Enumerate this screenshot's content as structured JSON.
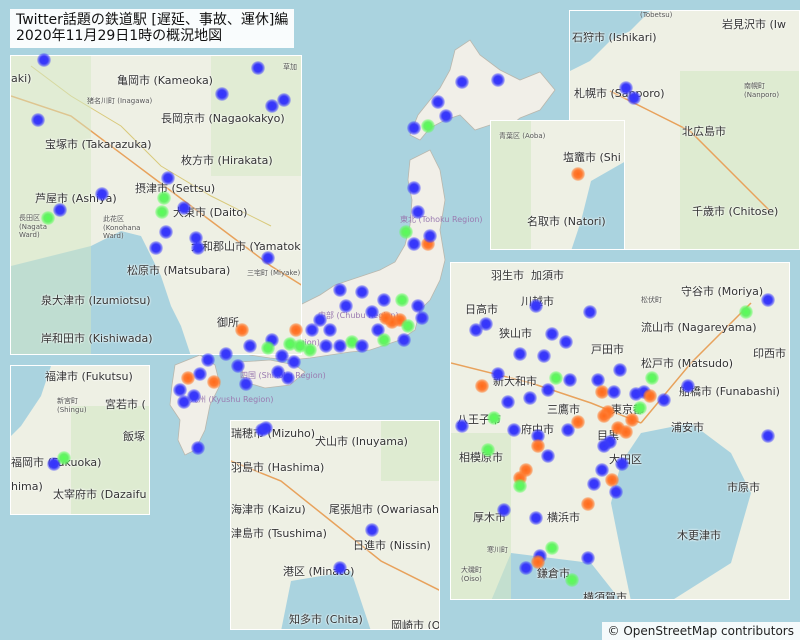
{
  "title": {
    "line1": "Twitter話題の鉄道駅 [遅延、事故、運休]編",
    "line2": "2020年11月29日1時の概況地図"
  },
  "attribution": "© OpenStreetMap contributors",
  "colors": {
    "delay": "#3a3af8",
    "normal": "#55ee55",
    "severe": "#ff6a1a",
    "sea": "#aad3df",
    "land": "#eef0e4"
  },
  "mainmap": {
    "region_labels": [
      "東北 (Tohoku Region)",
      "中部 (Chubu Region)",
      "中国 (Chugoku Region)",
      "四国 (Shikoku Region)",
      "九州 (Kyushu Region)"
    ]
  },
  "insets": {
    "kansai": {
      "labels": [
        "亀岡市 (Kameoka)",
        "猪名川町 (Inagawa)",
        "長岡京市 (Nagaokakyo)",
        "宝塚市 (Takarazuka)",
        "枚方市 (Hirakata)",
        "芦屋市 (Ashiya)",
        "摂津市 (Settsu)",
        "大東市 (Daito)",
        "長田区 (Nagata Ward)",
        "此花区 (Konohana Ward)",
        "大和郡山市 (Yamatok",
        "松原市 (Matsubara)",
        "三宅町 (Miyake)",
        "泉大津市 (Izumiotsu)",
        "岸和田市 (Kishiwada)",
        "御所",
        "草加",
        "aki)"
      ]
    },
    "sapporo": {
      "labels": [
        "(Tobetsu)",
        "岩見沢市 (Iw",
        "石狩市 (Ishikari)",
        "札幌市 (Sapporo)",
        "南幌町 (Nanporo)",
        "北広島市",
        "千歳市 (Chitose)"
      ]
    },
    "sendai": {
      "labels": [
        "青葉区 (Aoba)",
        "塩竈市 (Shi",
        "名取市 (Natori)"
      ]
    },
    "fukuoka": {
      "labels": [
        "福津市 (Fukutsu)",
        "新宮町 (Shingu)",
        "宮若市 (",
        "飯塚",
        "福岡市 (Fukuoka)",
        "太宰府市 (Dazaifu",
        "hima)"
      ]
    },
    "nagoya": {
      "labels": [
        "瑞穂市 (Mizuho)",
        "犬山市 (Inuyama)",
        "羽島市 (Hashima)",
        "海津市 (Kaizu)",
        "尾張旭市 (Owariasahi)",
        "津島市 (Tsushima)",
        "日進市 (Nissin)",
        "港区 (Minato)",
        "知多市 (Chita)",
        "岡崎市 (O"
      ]
    },
    "tokyo": {
      "labels": [
        "羽生市",
        "加須市",
        "守谷市 (Moriya)",
        "日高市",
        "川越市",
        "松伏町",
        "狭山市",
        "流山市 (Nagareyama)",
        "戸田市",
        "印西市",
        "新大和市",
        "松戸市 (Matsudo)",
        "船橋市 (Funabashi)",
        "八王子市",
        "三鷹市",
        "東京都",
        "浦安市",
        "府中市",
        "目黒",
        "相模原市",
        "大田区",
        "厚木市",
        "横浜市",
        "市原市",
        "寒川町",
        "木更津市",
        "大磯町 (Oiso)",
        "鎌倉市",
        "横須賀市"
      ]
    }
  },
  "station_counts": {
    "delay": 96,
    "normal": 38,
    "severe": 33
  }
}
